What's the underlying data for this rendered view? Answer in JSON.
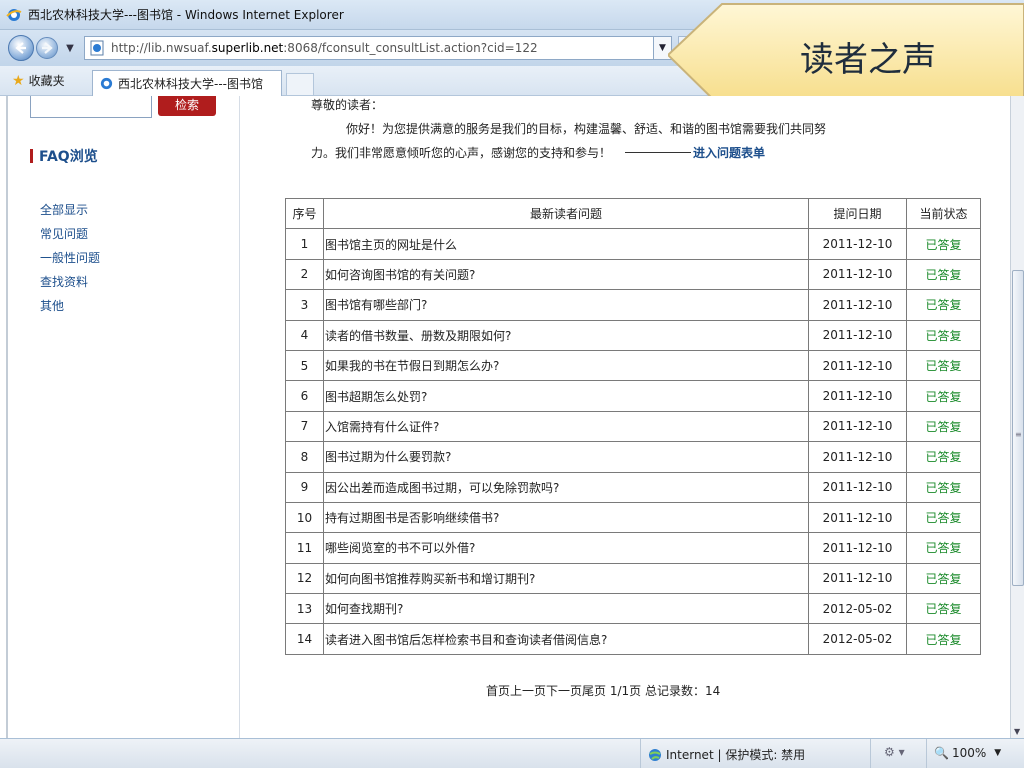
{
  "window": {
    "title": "西北农林科技大学---图书馆 - Windows Internet Explorer"
  },
  "address": {
    "prefix": "http://lib.nwsuaf.",
    "host": "superlib.net",
    "suffix": ":8068/fconsult_consultList.action?cid=122"
  },
  "favorites": {
    "label": "收藏夹"
  },
  "tab": {
    "label": "西北农林科技大学---图书馆"
  },
  "callout": {
    "text": "读者之声"
  },
  "sidebar": {
    "search_button": "检索",
    "faq_title": "FAQ浏览",
    "items": [
      {
        "label": "全部显示"
      },
      {
        "label": "常见问题"
      },
      {
        "label": "一般性问题"
      },
      {
        "label": "查找资料"
      },
      {
        "label": "其他"
      }
    ]
  },
  "intro": {
    "greeting": "尊敬的读者：",
    "line1": "你好！为您提供满意的服务是我们的目标，构建温馨、舒适、和谐的图书馆需要我们共同努",
    "line2": "力。我们非常愿意倾听您的心声，感谢您的支持和参与！",
    "link": "进入问题表单"
  },
  "table": {
    "headers": {
      "no": "序号",
      "question": "最新读者问题",
      "date": "提问日期",
      "status": "当前状态"
    },
    "rows": [
      {
        "no": "1",
        "q": "图书馆主页的网址是什么",
        "date": "2011-12-10",
        "status": "已答复"
      },
      {
        "no": "2",
        "q": "如何咨询图书馆的有关问题?",
        "date": "2011-12-10",
        "status": "已答复"
      },
      {
        "no": "3",
        "q": "图书馆有哪些部门?",
        "date": "2011-12-10",
        "status": "已答复"
      },
      {
        "no": "4",
        "q": "读者的借书数量、册数及期限如何?",
        "date": "2011-12-10",
        "status": "已答复"
      },
      {
        "no": "5",
        "q": "如果我的书在节假日到期怎么办?",
        "date": "2011-12-10",
        "status": "已答复"
      },
      {
        "no": "6",
        "q": "图书超期怎么处罚?",
        "date": "2011-12-10",
        "status": "已答复"
      },
      {
        "no": "7",
        "q": "入馆需持有什么证件?",
        "date": "2011-12-10",
        "status": "已答复"
      },
      {
        "no": "8",
        "q": "图书过期为什么要罚款?",
        "date": "2011-12-10",
        "status": "已答复"
      },
      {
        "no": "9",
        "q": "因公出差而造成图书过期，可以免除罚款吗?",
        "date": "2011-12-10",
        "status": "已答复"
      },
      {
        "no": "10",
        "q": "持有过期图书是否影响继续借书?",
        "date": "2011-12-10",
        "status": "已答复"
      },
      {
        "no": "11",
        "q": "哪些阅览室的书不可以外借?",
        "date": "2011-12-10",
        "status": "已答复"
      },
      {
        "no": "12",
        "q": "如何向图书馆推荐购买新书和增订期刊?",
        "date": "2011-12-10",
        "status": "已答复"
      },
      {
        "no": "13",
        "q": "如何查找期刊?",
        "date": "2012-05-02",
        "status": "已答复"
      },
      {
        "no": "14",
        "q": "读者进入图书馆后怎样检索书目和查询读者借阅信息?",
        "date": "2012-05-02",
        "status": "已答复"
      }
    ]
  },
  "pager": {
    "text": "首页上一页下一页尾页  1/1页 总记录数：14"
  },
  "status": {
    "zone": "Internet | 保护模式: 禁用",
    "zoom": "100%"
  }
}
